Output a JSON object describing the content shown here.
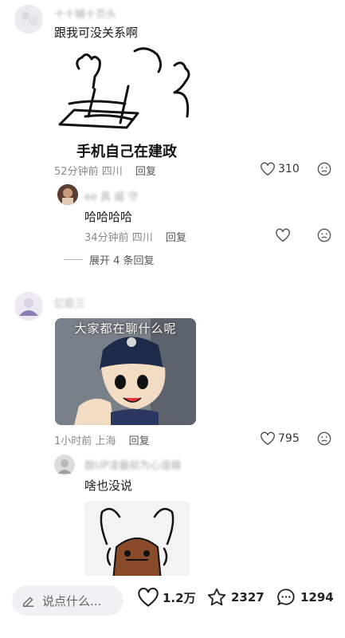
{
  "comments": [
    {
      "name": "十十输十页头",
      "text": "跟我可没关系啊",
      "image_caption": "手机自己在建政",
      "time": "52分钟前",
      "location": "四川",
      "reply_label": "回复",
      "likes": "310",
      "replies": [
        {
          "name": "ee 具 威 守",
          "text": "哈哈哈哈",
          "time": "34分钟前",
          "location": "四川",
          "reply_label": "回复",
          "likes": ""
        }
      ],
      "expand_label": "展开 4 条回复"
    },
    {
      "name": "亿臣三",
      "image_caption": "大家都在聊什么呢",
      "time": "1小时前",
      "location": "上海",
      "reply_label": "回复",
      "likes": "795",
      "replies": [
        {
          "name": "鼓UP凌最前为心遥辑",
          "text": "啥也没说"
        }
      ]
    }
  ],
  "bottom_bar": {
    "input_placeholder": "说点什么...",
    "likes": "1.2万",
    "favorites": "2327",
    "comments": "1294"
  },
  "colors": {
    "meta_gray": "#8a8a8a",
    "text_dark": "#1a1a1a",
    "input_bg": "#f1f1f3"
  }
}
